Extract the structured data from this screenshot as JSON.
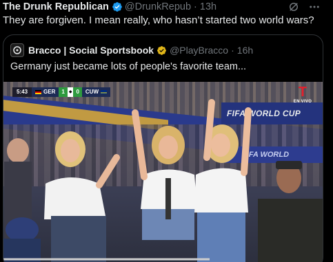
{
  "tweet": {
    "author_name": "The Drunk Republican",
    "handle": "@DrunkRepub",
    "separator": "·",
    "time": "13h",
    "text": "They are forgiven. I mean really, who hasn’t started two world wars?"
  },
  "quote": {
    "author_name": "Bracco | Social Sportsbook",
    "handle": "@PlayBracco",
    "separator": "·",
    "time": "16h",
    "text": "Germany just became lots of people's favorite team..."
  },
  "media": {
    "scorebug": {
      "clock": "5:43",
      "team_home": "GER",
      "score_home": "1",
      "score_away": "0",
      "team_away": "CUW"
    },
    "broadcaster_tag": "EN VIVO",
    "board_text_1": "FIFA WORLD CUP",
    "board_text_2": "FIFA WORLD"
  },
  "colors": {
    "verified_blue": "#1d9bf0",
    "verified_gold": "#e2b719",
    "text_primary": "#e7e9ea",
    "text_secondary": "#71767b",
    "border": "#2f3336"
  },
  "icons": {
    "grok": "grok-icon",
    "more": "more-icon",
    "verified": "verified-badge-icon",
    "gold_verified": "gold-verified-badge-icon"
  }
}
